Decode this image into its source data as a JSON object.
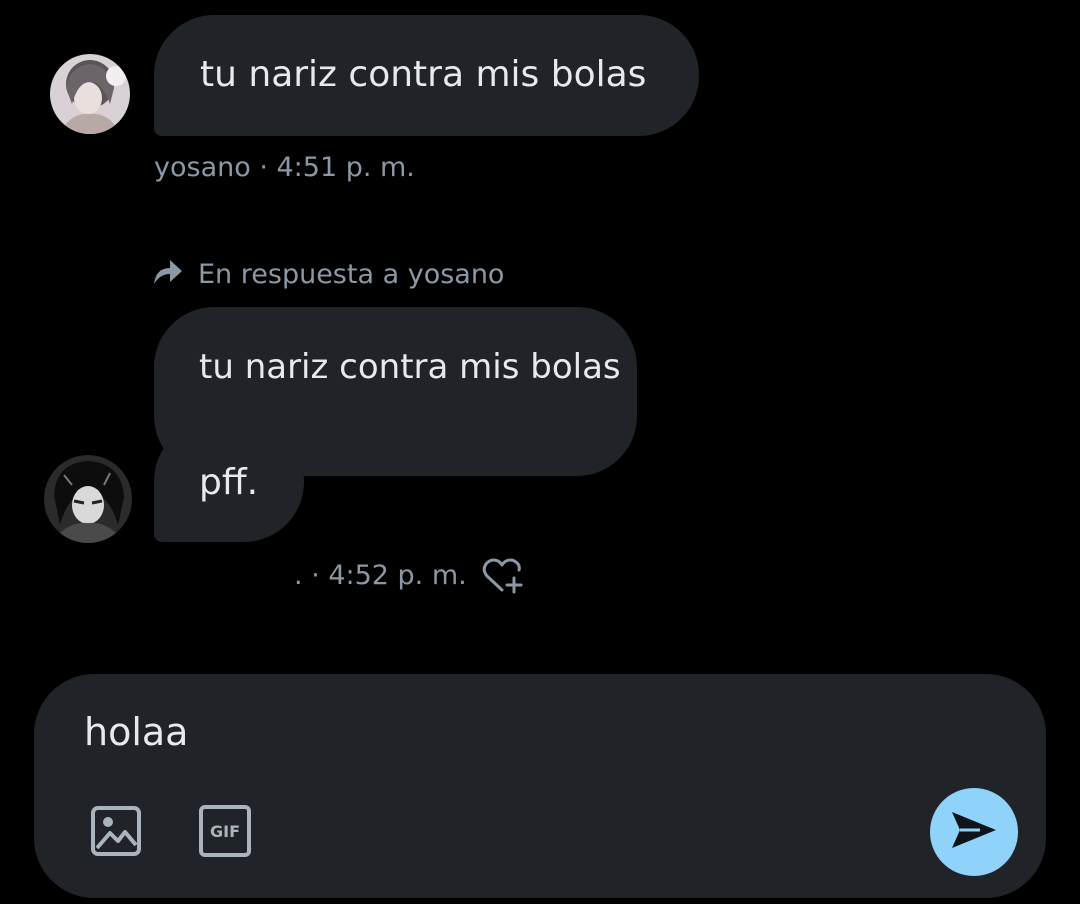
{
  "messages": [
    {
      "author": "yosano",
      "avatar": "avatar-yosano",
      "text": "tu nariz contra mis bolas",
      "meta": "yosano · 4:51 p. m."
    }
  ],
  "reply": {
    "context_label": "En respuesta a yosano",
    "quoted_text": "tu nariz contra mis bolas",
    "text": "pff.",
    "meta": ". · 4:52 p. m."
  },
  "composer": {
    "value": "holaa",
    "gif_label": "GIF"
  },
  "icons": {
    "reply": "reply-arrow-icon",
    "react": "heart-plus-icon",
    "image": "image-icon",
    "gif": "gif-icon",
    "send": "send-icon"
  },
  "colors": {
    "background": "#000000",
    "bubble": "#202327",
    "text": "#e7e9ea",
    "muted": "#8b98a5",
    "accent": "#8fd3fa"
  }
}
